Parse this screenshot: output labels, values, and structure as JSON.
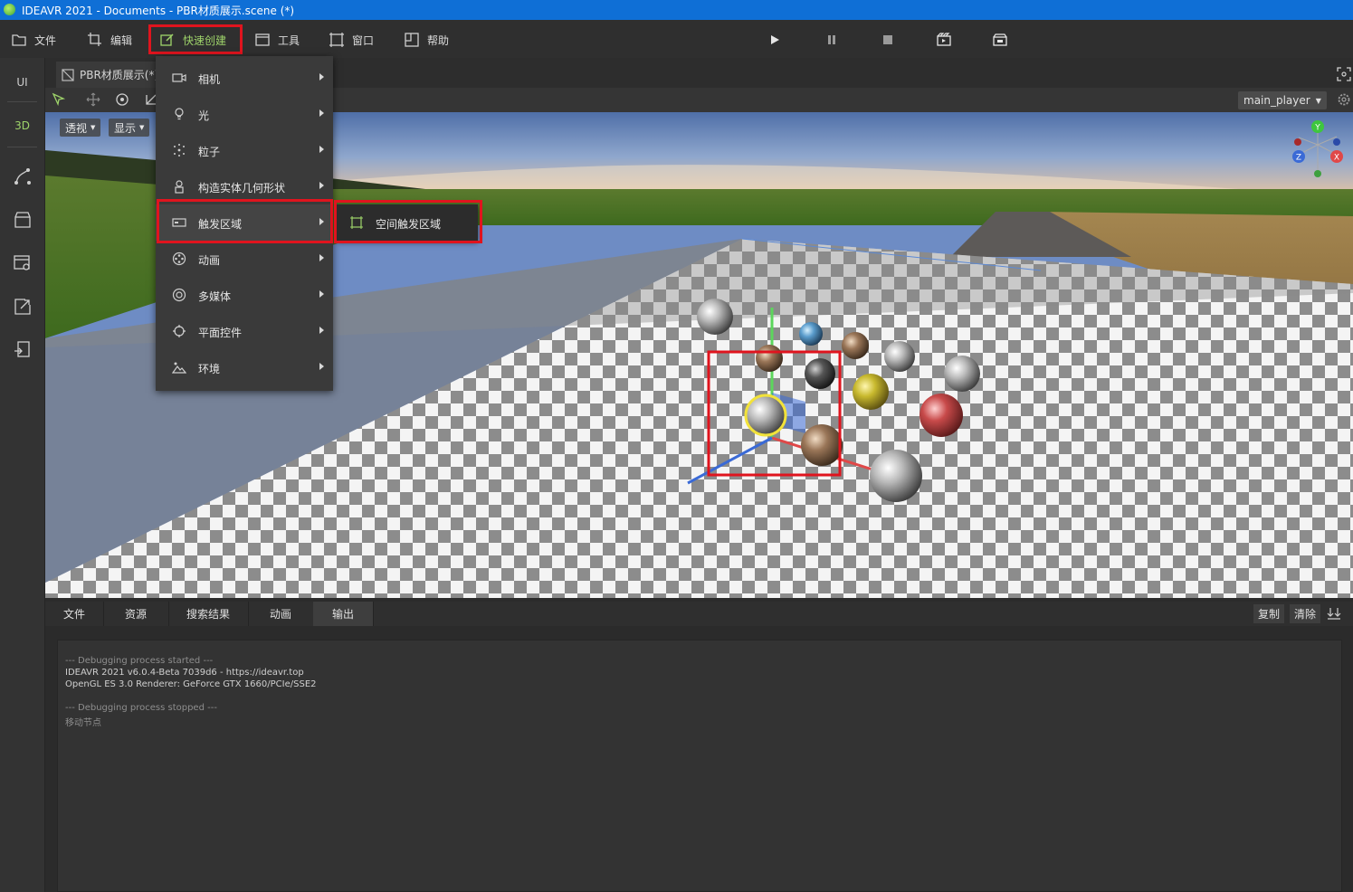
{
  "window": {
    "title": "IDEAVR 2021 - Documents - PBR材质展示.scene (*)"
  },
  "menubar": {
    "items": [
      {
        "label": "文件",
        "icon": "folder-icon"
      },
      {
        "label": "编辑",
        "icon": "crop-icon"
      },
      {
        "label": "快速创建",
        "icon": "edit-icon",
        "active": true
      },
      {
        "label": "工具",
        "icon": "window-icon"
      },
      {
        "label": "窗口",
        "icon": "frame-icon"
      },
      {
        "label": "帮助",
        "icon": "help-icon"
      }
    ],
    "playback": [
      "play-icon",
      "pause-icon",
      "stop-icon",
      "record-icon",
      "clapper-icon"
    ]
  },
  "leftbar": {
    "items": [
      {
        "label": "UI"
      },
      {
        "label": "3D",
        "active": true
      }
    ],
    "icons": [
      "path-icon",
      "store-icon",
      "settings-window-icon",
      "export-icon",
      "publish-icon"
    ]
  },
  "scene_tab": {
    "label": "PBR材质展示(*)"
  },
  "viewport": {
    "perspective_label": "透视",
    "display_label": "显示",
    "player_select": "main_player",
    "gizmo": {
      "x": "X",
      "y": "Y",
      "z": "Z"
    }
  },
  "quick_create_menu": {
    "items": [
      {
        "label": "相机",
        "icon": "camera-icon"
      },
      {
        "label": "光",
        "icon": "bulb-icon"
      },
      {
        "label": "粒子",
        "icon": "particle-icon"
      },
      {
        "label": "构造实体几何形状",
        "icon": "csg-icon"
      },
      {
        "label": "触发区域",
        "icon": "trigger-icon",
        "highlighted": true
      },
      {
        "label": "动画",
        "icon": "film-reel-icon"
      },
      {
        "label": "多媒体",
        "icon": "media-icon"
      },
      {
        "label": "平面控件",
        "icon": "widget-icon"
      },
      {
        "label": "环境",
        "icon": "landscape-icon"
      }
    ],
    "submenu": {
      "label": "空间触发区域",
      "icon": "area-icon"
    }
  },
  "bottom_panel": {
    "tabs": [
      "文件",
      "资源",
      "搜索结果",
      "动画",
      "输出"
    ],
    "active_tab": "输出",
    "copy_label": "复制",
    "clear_label": "清除",
    "console": [
      "--- Debugging process started ---",
      "IDEAVR 2021 v6.0.4-Beta 7039d6 - https://ideavr.top",
      "OpenGL ES 3.0 Renderer: GeForce GTX 1660/PCIe/SSE2",
      "",
      "--- Debugging process stopped ---",
      "移动节点"
    ]
  },
  "colors": {
    "accent_green": "#9ed36a",
    "highlight_red": "#e0141e",
    "titlebar_blue": "#0f6fd6"
  }
}
